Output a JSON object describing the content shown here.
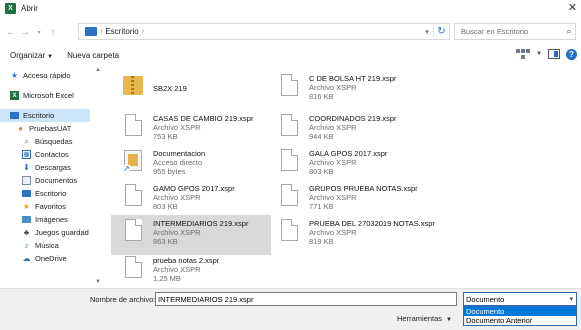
{
  "window": {
    "title": "Abrir"
  },
  "nav": {
    "path": [
      "Escritorio"
    ],
    "search_placeholder": "Buscar en Escritorio"
  },
  "toolbar": {
    "organize": "Organizar",
    "new_folder": "Nueva carpeta"
  },
  "sidebar": {
    "items": [
      {
        "label": "Acceso rápido",
        "icon": "star-icon"
      },
      {
        "label": "Microsoft Excel",
        "icon": "excel-icon"
      },
      {
        "label": "Escritorio",
        "icon": "desktop-folder-icon",
        "selected": true
      },
      {
        "label": "PruebasUAT",
        "icon": "user-icon"
      },
      {
        "label": "Búsquedas",
        "icon": "search-icon"
      },
      {
        "label": "Contactos",
        "icon": "contacts-icon"
      },
      {
        "label": "Descargas",
        "icon": "download-icon"
      },
      {
        "label": "Documentos",
        "icon": "documents-icon"
      },
      {
        "label": "Escritorio",
        "icon": "desktop-folder-icon"
      },
      {
        "label": "Favoritos",
        "icon": "favorites-icon"
      },
      {
        "label": "Imágenes",
        "icon": "images-icon"
      },
      {
        "label": "Juegos guardad",
        "icon": "games-icon"
      },
      {
        "label": "Música",
        "icon": "music-icon"
      },
      {
        "label": "OneDrive",
        "icon": "onedrive-icon"
      }
    ]
  },
  "files": [
    {
      "name": "SB2X 219",
      "type": "",
      "size": "",
      "icon": "zip-folder-icon"
    },
    {
      "name": "C DE BOLSA HT 219.xspr",
      "type": "Archivo XSPR",
      "size": "816 KB",
      "icon": "document-icon"
    },
    {
      "name": "CASAS DE CAMBIO 219.xspr",
      "type": "Archivo XSPR",
      "size": "753 KB",
      "icon": "document-icon"
    },
    {
      "name": "COORDINADOS 219.xspr",
      "type": "Archivo XSPR",
      "size": "944 KB",
      "icon": "document-icon"
    },
    {
      "name": "Documentacion",
      "type": "Acceso directo",
      "size": "955 bytes",
      "icon": "shortcut-icon"
    },
    {
      "name": "GALA GPOS 2017.xspr",
      "type": "Archivo XSPR",
      "size": "803 KB",
      "icon": "document-icon"
    },
    {
      "name": "GAMO GPOS 2017.xspr",
      "type": "Archivo XSPR",
      "size": "803 KB",
      "icon": "document-icon"
    },
    {
      "name": "GRUPOS PRUEBA NOTAS.xspr",
      "type": "Archivo XSPR",
      "size": "771 KB",
      "icon": "document-icon"
    },
    {
      "name": "INTERMEDIARIOS 219.xspr",
      "type": "Archivo XSPR",
      "size": "863 KB",
      "icon": "document-icon",
      "selected": true
    },
    {
      "name": "PRUEBA DEL 27032019 NOTAS.xspr",
      "type": "Archivo XSPR",
      "size": "819 KB",
      "icon": "document-icon"
    },
    {
      "name": "prueba notas 2.xspr",
      "type": "Archivo XSPR",
      "size": "1,25 MB",
      "icon": "document-icon"
    }
  ],
  "bottom": {
    "filename_label": "Nombre de archivo:",
    "filename_value": "INTERMEDIARIOS 219.xspr",
    "filetype_selected": "Documento",
    "filetype_options": [
      "Documento",
      "Documento Anterior"
    ],
    "tools_label": "Herramientas"
  },
  "colors": {
    "selection": "#cce4f7",
    "accent": "#0078d7",
    "excel": "#1e7145"
  }
}
